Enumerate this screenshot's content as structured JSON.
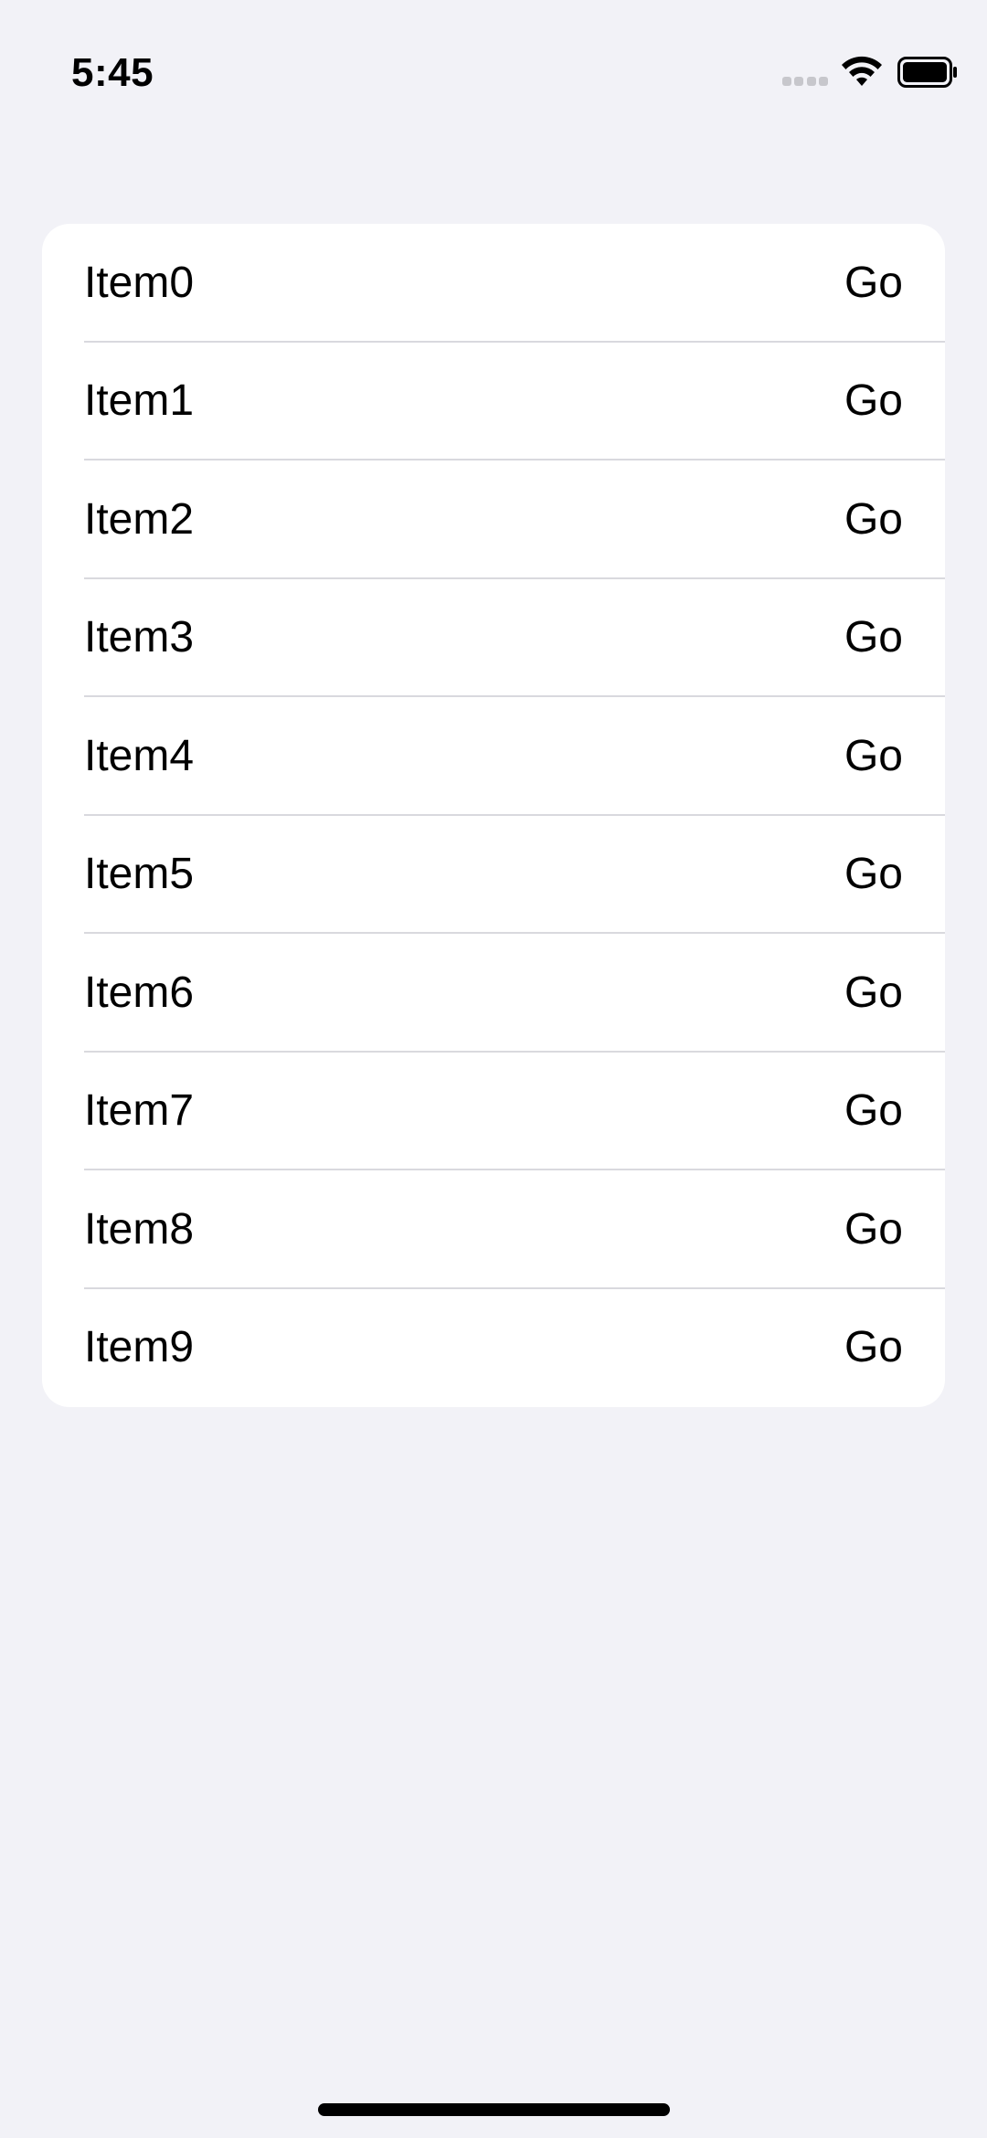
{
  "status_bar": {
    "time": "5:45"
  },
  "list": {
    "rows": [
      {
        "label": "Item0",
        "action": "Go"
      },
      {
        "label": "Item1",
        "action": "Go"
      },
      {
        "label": "Item2",
        "action": "Go"
      },
      {
        "label": "Item3",
        "action": "Go"
      },
      {
        "label": "Item4",
        "action": "Go"
      },
      {
        "label": "Item5",
        "action": "Go"
      },
      {
        "label": "Item6",
        "action": "Go"
      },
      {
        "label": "Item7",
        "action": "Go"
      },
      {
        "label": "Item8",
        "action": "Go"
      },
      {
        "label": "Item9",
        "action": "Go"
      }
    ]
  },
  "icons": {
    "signal": "cellular-signal-icon",
    "wifi": "wifi-icon",
    "battery": "battery-icon"
  },
  "colors": {
    "background": "#f2f2f7",
    "card": "#ffffff",
    "separator": "#d9d9de",
    "text": "#000000"
  }
}
